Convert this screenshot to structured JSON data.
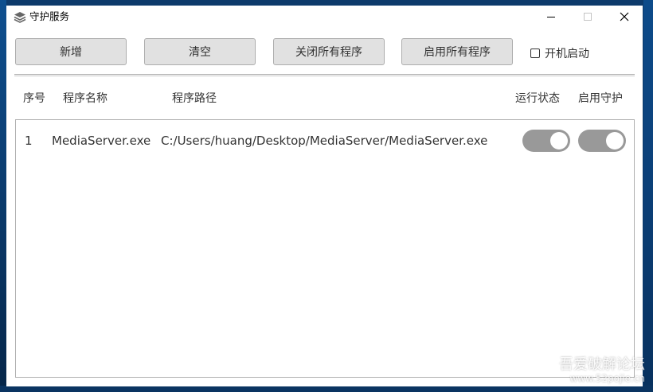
{
  "window": {
    "title": "守护服务",
    "title_icon": "layers-icon"
  },
  "toolbar": {
    "add_label": "新增",
    "clear_label": "清空",
    "close_all_label": "关闭所有程序",
    "start_all_label": "启用所有程序",
    "autostart_label": "开机启动",
    "autostart_checked": false
  },
  "table": {
    "headers": {
      "index": "序号",
      "name": "程序名称",
      "path": "程序路径",
      "status": "运行状态",
      "guard": "启用守护"
    },
    "rows": [
      {
        "index": "1",
        "name": "MediaServer.exe",
        "path": "C:/Users/huang/Desktop/MediaServer/MediaServer.exe",
        "status_on": true,
        "guard_on": true
      }
    ]
  },
  "watermark": {
    "text": "吾爱破解论坛",
    "url": "www.52pojie.cn"
  },
  "colors": {
    "toggle_bg": "#999999",
    "button_bg": "#e1e1e1",
    "button_border": "#adadad"
  }
}
